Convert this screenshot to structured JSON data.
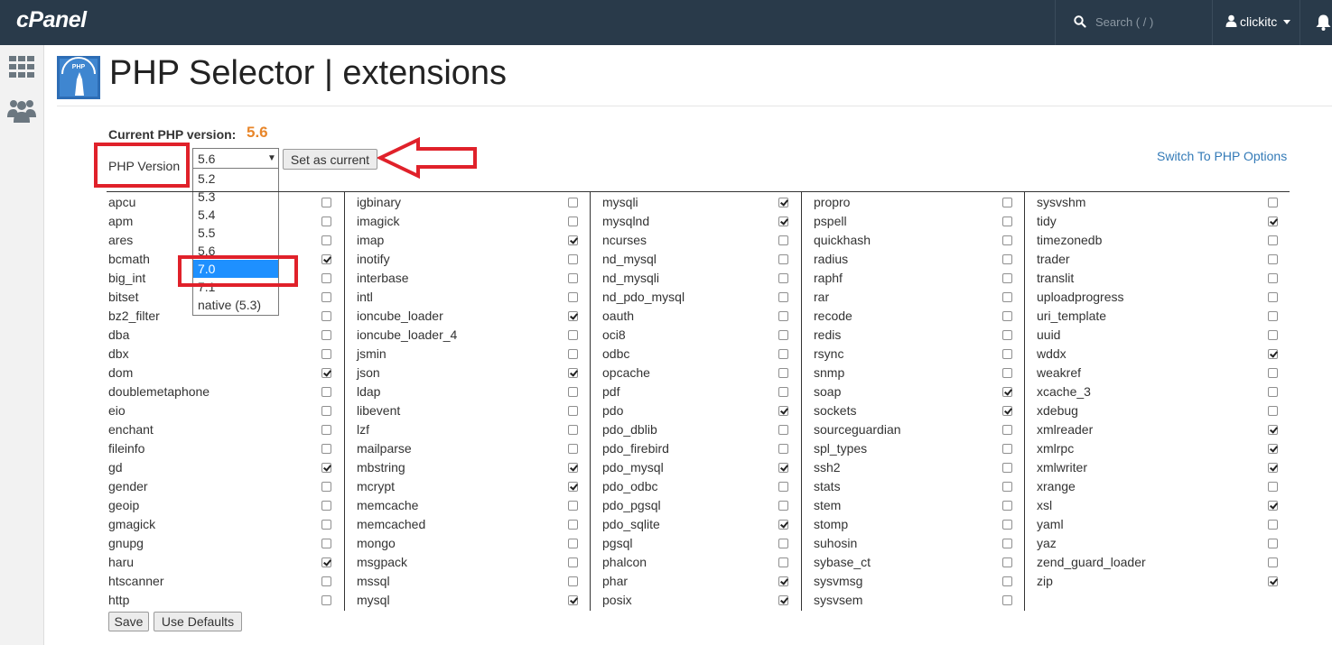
{
  "header": {
    "logo": "cPanel",
    "search_placeholder": "Search ( / )",
    "username": "clickitc"
  },
  "page": {
    "title": "PHP Selector | extensions",
    "current_label": "Current PHP version:",
    "current_value": "5.6",
    "version_label": "PHP Version",
    "selected_version": "5.6",
    "version_options": [
      "5.2",
      "5.3",
      "5.4",
      "5.5",
      "5.6",
      "7.0",
      "7.1",
      "native (5.3)"
    ],
    "highlighted_option": "7.0",
    "set_current_label": "Set as current",
    "switch_link": "Switch To PHP Options",
    "save_label": "Save",
    "defaults_label": "Use Defaults"
  },
  "colors": {
    "topbar": "#293a4a",
    "accent_version": "#e8862a",
    "annotation_red": "#e0212a",
    "link": "#337ab7",
    "highlight": "#1e90ff"
  },
  "extensions": [
    [
      {
        "name": "apcu",
        "on": false
      },
      {
        "name": "apm",
        "on": false
      },
      {
        "name": "ares",
        "on": false
      },
      {
        "name": "bcmath",
        "on": true
      },
      {
        "name": "big_int",
        "on": false
      },
      {
        "name": "bitset",
        "on": false
      },
      {
        "name": "bz2_filter",
        "on": false
      },
      {
        "name": "dba",
        "on": false
      },
      {
        "name": "dbx",
        "on": false
      },
      {
        "name": "dom",
        "on": true
      },
      {
        "name": "doublemetaphone",
        "on": false
      },
      {
        "name": "eio",
        "on": false
      },
      {
        "name": "enchant",
        "on": false
      },
      {
        "name": "fileinfo",
        "on": false
      },
      {
        "name": "gd",
        "on": true
      },
      {
        "name": "gender",
        "on": false
      },
      {
        "name": "geoip",
        "on": false
      },
      {
        "name": "gmagick",
        "on": false
      },
      {
        "name": "gnupg",
        "on": false
      },
      {
        "name": "haru",
        "on": true
      },
      {
        "name": "htscanner",
        "on": false
      },
      {
        "name": "http",
        "on": false
      }
    ],
    [
      {
        "name": "igbinary",
        "on": false
      },
      {
        "name": "imagick",
        "on": false
      },
      {
        "name": "imap",
        "on": true
      },
      {
        "name": "inotify",
        "on": false
      },
      {
        "name": "interbase",
        "on": false
      },
      {
        "name": "intl",
        "on": false
      },
      {
        "name": "ioncube_loader",
        "on": true
      },
      {
        "name": "ioncube_loader_4",
        "on": false
      },
      {
        "name": "jsmin",
        "on": false
      },
      {
        "name": "json",
        "on": true
      },
      {
        "name": "ldap",
        "on": false
      },
      {
        "name": "libevent",
        "on": false
      },
      {
        "name": "lzf",
        "on": false
      },
      {
        "name": "mailparse",
        "on": false
      },
      {
        "name": "mbstring",
        "on": true
      },
      {
        "name": "mcrypt",
        "on": true
      },
      {
        "name": "memcache",
        "on": false
      },
      {
        "name": "memcached",
        "on": false
      },
      {
        "name": "mongo",
        "on": false
      },
      {
        "name": "msgpack",
        "on": false
      },
      {
        "name": "mssql",
        "on": false
      },
      {
        "name": "mysql",
        "on": true
      }
    ],
    [
      {
        "name": "mysqli",
        "on": true
      },
      {
        "name": "mysqlnd",
        "on": true
      },
      {
        "name": "ncurses",
        "on": false
      },
      {
        "name": "nd_mysql",
        "on": false
      },
      {
        "name": "nd_mysqli",
        "on": false
      },
      {
        "name": "nd_pdo_mysql",
        "on": false
      },
      {
        "name": "oauth",
        "on": false
      },
      {
        "name": "oci8",
        "on": false
      },
      {
        "name": "odbc",
        "on": false
      },
      {
        "name": "opcache",
        "on": false
      },
      {
        "name": "pdf",
        "on": false
      },
      {
        "name": "pdo",
        "on": true
      },
      {
        "name": "pdo_dblib",
        "on": false
      },
      {
        "name": "pdo_firebird",
        "on": false
      },
      {
        "name": "pdo_mysql",
        "on": true
      },
      {
        "name": "pdo_odbc",
        "on": false
      },
      {
        "name": "pdo_pgsql",
        "on": false
      },
      {
        "name": "pdo_sqlite",
        "on": true
      },
      {
        "name": "pgsql",
        "on": false
      },
      {
        "name": "phalcon",
        "on": false
      },
      {
        "name": "phar",
        "on": true
      },
      {
        "name": "posix",
        "on": true
      }
    ],
    [
      {
        "name": "propro",
        "on": false
      },
      {
        "name": "pspell",
        "on": false
      },
      {
        "name": "quickhash",
        "on": false
      },
      {
        "name": "radius",
        "on": false
      },
      {
        "name": "raphf",
        "on": false
      },
      {
        "name": "rar",
        "on": false
      },
      {
        "name": "recode",
        "on": false
      },
      {
        "name": "redis",
        "on": false
      },
      {
        "name": "rsync",
        "on": false
      },
      {
        "name": "snmp",
        "on": false
      },
      {
        "name": "soap",
        "on": true
      },
      {
        "name": "sockets",
        "on": true
      },
      {
        "name": "sourceguardian",
        "on": false
      },
      {
        "name": "spl_types",
        "on": false
      },
      {
        "name": "ssh2",
        "on": false
      },
      {
        "name": "stats",
        "on": false
      },
      {
        "name": "stem",
        "on": false
      },
      {
        "name": "stomp",
        "on": false
      },
      {
        "name": "suhosin",
        "on": false
      },
      {
        "name": "sybase_ct",
        "on": false
      },
      {
        "name": "sysvmsg",
        "on": false
      },
      {
        "name": "sysvsem",
        "on": false
      }
    ],
    [
      {
        "name": "sysvshm",
        "on": false
      },
      {
        "name": "tidy",
        "on": true
      },
      {
        "name": "timezonedb",
        "on": false
      },
      {
        "name": "trader",
        "on": false
      },
      {
        "name": "translit",
        "on": false
      },
      {
        "name": "uploadprogress",
        "on": false
      },
      {
        "name": "uri_template",
        "on": false
      },
      {
        "name": "uuid",
        "on": false
      },
      {
        "name": "wddx",
        "on": true
      },
      {
        "name": "weakref",
        "on": false
      },
      {
        "name": "xcache_3",
        "on": false
      },
      {
        "name": "xdebug",
        "on": false
      },
      {
        "name": "xmlreader",
        "on": true
      },
      {
        "name": "xmlrpc",
        "on": true
      },
      {
        "name": "xmlwriter",
        "on": true
      },
      {
        "name": "xrange",
        "on": false
      },
      {
        "name": "xsl",
        "on": true
      },
      {
        "name": "yaml",
        "on": false
      },
      {
        "name": "yaz",
        "on": false
      },
      {
        "name": "zend_guard_loader",
        "on": false
      },
      {
        "name": "zip",
        "on": true
      }
    ]
  ]
}
